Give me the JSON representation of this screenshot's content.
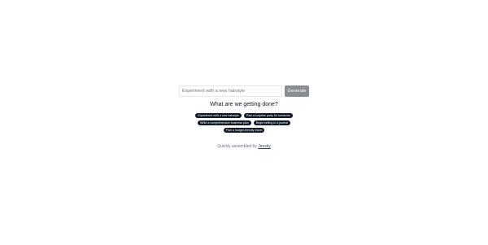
{
  "search": {
    "placeholder": "Experiment with a new hairstyle",
    "value": ""
  },
  "generate_button": {
    "label": "Generate"
  },
  "heading": "What are we getting done?",
  "suggestions": [
    "Experiment with a new hairstyle",
    "Plan a surprise party for someone",
    "Write a comprehensive business plan",
    "Begin writing in a journal",
    "Plan a budget-friendly travel"
  ],
  "footer": {
    "text": "Quickly assembled by",
    "link_label": "Jensky"
  },
  "colors": {
    "chip_bg": "#111827",
    "button_bg": "#8a8d94",
    "text": "#111827",
    "muted": "#6b7280"
  }
}
